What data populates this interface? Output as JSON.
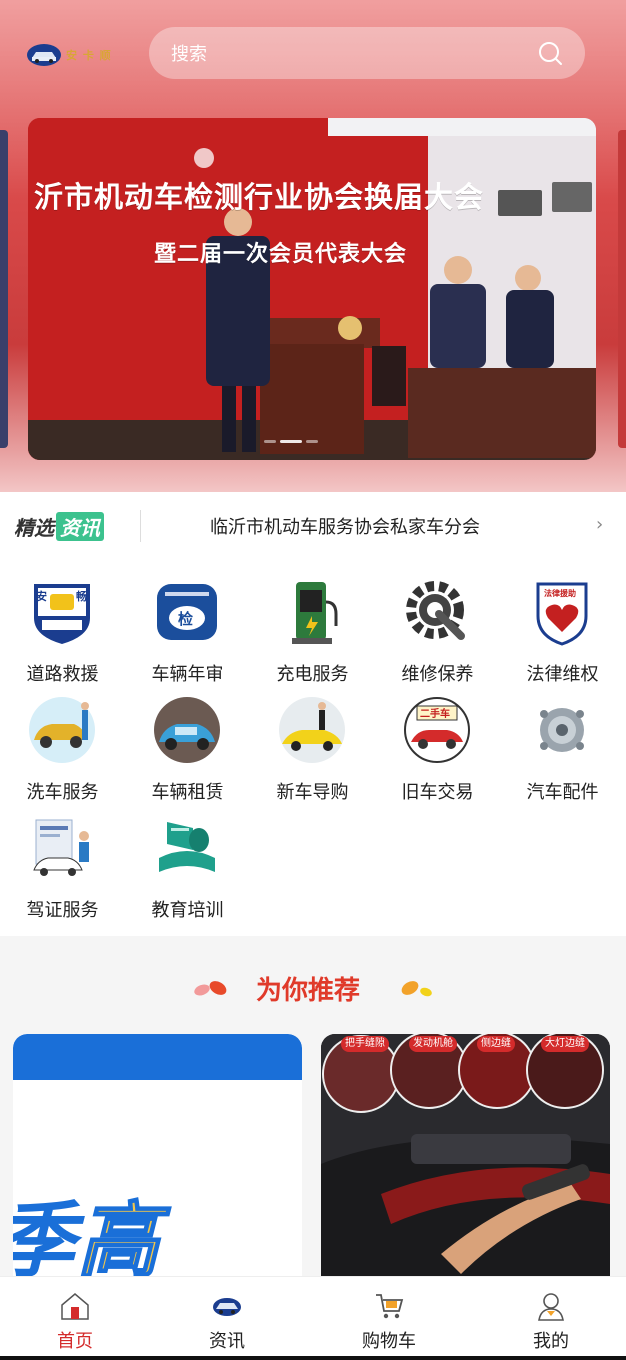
{
  "header": {
    "logo_text": "安 卡 顺",
    "search_placeholder": "搜索"
  },
  "banner": {
    "headline_line1": "沂市机动车检测行业协会换届大会",
    "headline_line2": "暨二届一次会员代表大会",
    "slide_count": 3,
    "active_slide": 2
  },
  "news": {
    "badge_part1": "精选",
    "badge_part2": "资讯",
    "headline": "临沂市机动车服务协会私家车分会"
  },
  "services": [
    {
      "label": "道路救援",
      "icon": "road-rescue-icon"
    },
    {
      "label": "车辆年审",
      "icon": "annual-inspection-icon"
    },
    {
      "label": "充电服务",
      "icon": "charging-station-icon"
    },
    {
      "label": "维修保养",
      "icon": "repair-gear-icon"
    },
    {
      "label": "法律维权",
      "icon": "legal-aid-icon"
    },
    {
      "label": "洗车服务",
      "icon": "car-wash-icon"
    },
    {
      "label": "车辆租赁",
      "icon": "car-rental-icon"
    },
    {
      "label": "新车导购",
      "icon": "new-car-icon"
    },
    {
      "label": "旧车交易",
      "icon": "used-car-icon"
    },
    {
      "label": "汽车配件",
      "icon": "car-parts-icon"
    },
    {
      "label": "驾证服务",
      "icon": "driver-license-icon"
    },
    {
      "label": "教育培训",
      "icon": "education-icon"
    }
  ],
  "recommend": {
    "title": "为你推荐",
    "card_left_text_a": "季",
    "card_left_text_b": "高",
    "card_right_tags": [
      "把手缝隙",
      "发动机舱",
      "侧边缝",
      "大灯边缝"
    ]
  },
  "tabbar": [
    {
      "label": "首页",
      "icon": "home-icon",
      "active": true
    },
    {
      "label": "资讯",
      "icon": "news-car-icon",
      "active": false
    },
    {
      "label": "购物车",
      "icon": "cart-icon",
      "active": false
    },
    {
      "label": "我的",
      "icon": "profile-icon",
      "active": false
    }
  ],
  "colors": {
    "accent": "#d42b2b",
    "recommend_title": "#e03a2a",
    "badge_green": "#3cc28e",
    "card_blue": "#1a6fd8"
  }
}
